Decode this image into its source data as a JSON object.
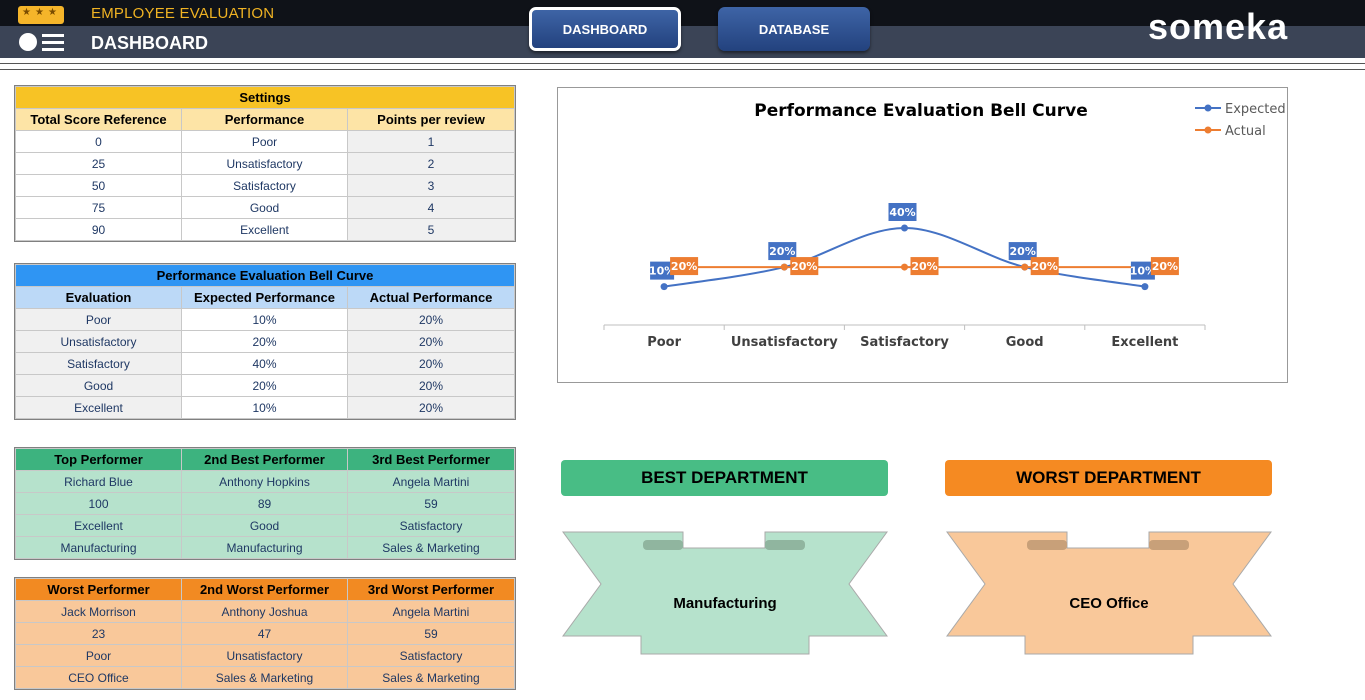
{
  "header": {
    "app_title": "EMPLOYEE EVALUATION",
    "page_title": "DASHBOARD",
    "nav": [
      {
        "label": "DASHBOARD",
        "active": true
      },
      {
        "label": "DATABASE",
        "active": false
      }
    ],
    "brand": "someka"
  },
  "settings": {
    "title": "Settings",
    "columns": [
      "Total Score Reference",
      "Performance",
      "Points per review"
    ],
    "rows": [
      [
        "0",
        "Poor",
        "1"
      ],
      [
        "25",
        "Unsatisfactory",
        "2"
      ],
      [
        "50",
        "Satisfactory",
        "3"
      ],
      [
        "75",
        "Good",
        "4"
      ],
      [
        "90",
        "Excellent",
        "5"
      ]
    ]
  },
  "bell_table": {
    "title": "Performance Evaluation Bell Curve",
    "columns": [
      "Evaluation",
      "Expected Performance",
      "Actual Performance"
    ],
    "rows": [
      [
        "Poor",
        "10%",
        "20%"
      ],
      [
        "Unsatisfactory",
        "20%",
        "20%"
      ],
      [
        "Satisfactory",
        "40%",
        "20%"
      ],
      [
        "Good",
        "20%",
        "20%"
      ],
      [
        "Excellent",
        "10%",
        "20%"
      ]
    ]
  },
  "top_performers": {
    "columns": [
      "Top Performer",
      "2nd Best Performer",
      "3rd Best Performer"
    ],
    "rows": [
      [
        "Richard Blue",
        "Anthony Hopkins",
        "Angela Martini"
      ],
      [
        "100",
        "89",
        "59"
      ],
      [
        "Excellent",
        "Good",
        "Satisfactory"
      ],
      [
        "Manufacturing",
        "Manufacturing",
        "Sales & Marketing"
      ]
    ]
  },
  "worst_performers": {
    "columns": [
      "Worst Performer",
      "2nd Worst Performer",
      "3rd Worst Performer"
    ],
    "rows": [
      [
        "Jack Morrison",
        "Anthony Joshua",
        "Angela Martini"
      ],
      [
        "23",
        "47",
        "59"
      ],
      [
        "Poor",
        "Unsatisfactory",
        "Satisfactory"
      ],
      [
        "CEO Office",
        "Sales & Marketing",
        "Sales & Marketing"
      ]
    ]
  },
  "departments": {
    "best_label": "BEST DEPARTMENT",
    "best_value": "Manufacturing",
    "worst_label": "WORST DEPARTMENT",
    "worst_value": "CEO Office"
  },
  "colors": {
    "settings_header": "#f7c325",
    "settings_sub": "#fde4a6",
    "bell_header": "#2f95f3",
    "bell_sub": "#bcd9f7",
    "top_header": "#3db37f",
    "top_body": "#b6e2cc",
    "worst_header": "#f28a22",
    "worst_body": "#f9c89a",
    "best_head": "#48bd85",
    "worst_head": "#f58a22",
    "expected": "#4472c4",
    "actual": "#ed7d31"
  },
  "chart_data": {
    "type": "line",
    "title": "Performance Evaluation Bell Curve",
    "categories": [
      "Poor",
      "Unsatisfactory",
      "Satisfactory",
      "Good",
      "Excellent"
    ],
    "series": [
      {
        "name": "Expected",
        "values": [
          0.1,
          0.2,
          0.4,
          0.2,
          0.1
        ],
        "labels": [
          "10%",
          "20%",
          "40%",
          "20%",
          "10%"
        ]
      },
      {
        "name": "Actual",
        "values": [
          0.2,
          0.2,
          0.2,
          0.2,
          0.2
        ],
        "labels": [
          "20%",
          "20%",
          "20%",
          "20%",
          "20%"
        ]
      }
    ],
    "legend": "top-right",
    "smooth": true,
    "grid": false
  }
}
